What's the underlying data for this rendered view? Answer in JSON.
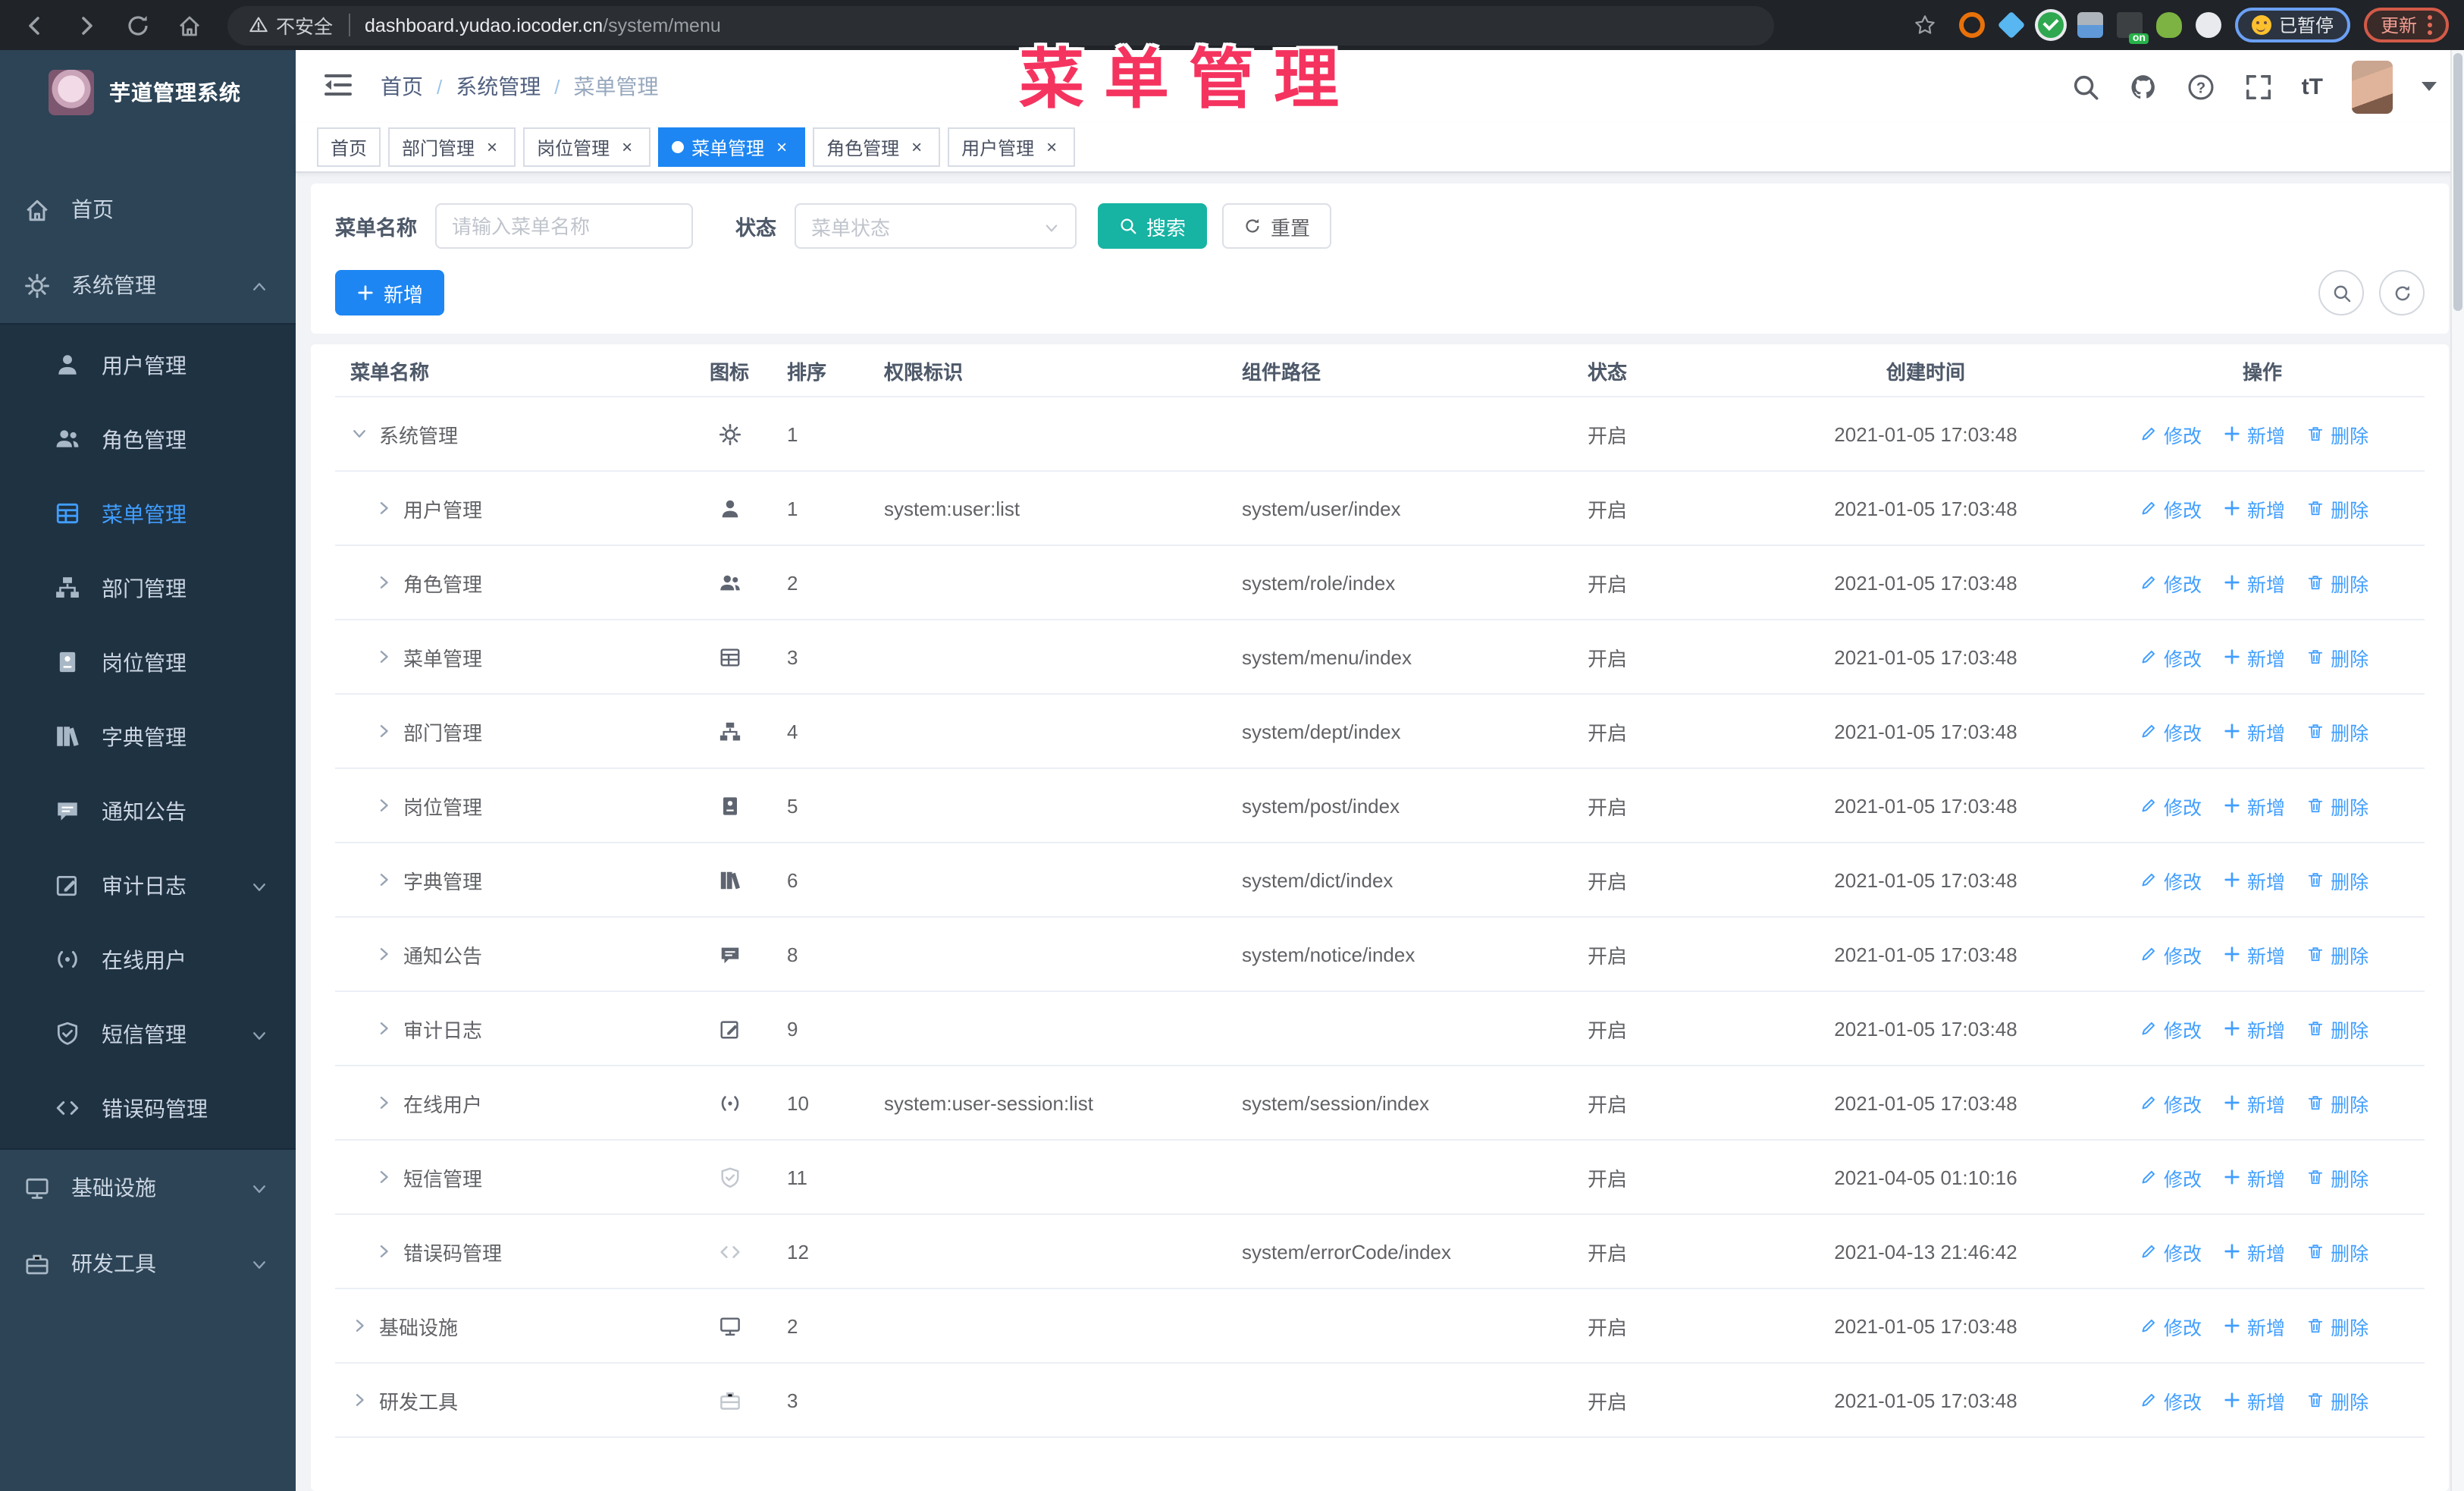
{
  "browser": {
    "not_secure": "不安全",
    "url_host": "dashboard.yudao.iocoder.cn",
    "url_path": "/system/menu",
    "paused_label": "已暂停",
    "update_label": "更新",
    "nav_icons": [
      "back-icon",
      "forward-icon",
      "reload-icon",
      "home-icon",
      "bookmark-star-icon"
    ]
  },
  "watermark": "菜单管理",
  "sidebar": {
    "app_title": "芋道管理系统",
    "items": [
      {
        "label": "首页",
        "icon": "home-icon",
        "level": 0
      },
      {
        "label": "系统管理",
        "icon": "gear-icon",
        "level": 0,
        "arrow": "up"
      },
      {
        "label": "用户管理",
        "icon": "user-icon",
        "level": 1
      },
      {
        "label": "角色管理",
        "icon": "users-icon",
        "level": 1
      },
      {
        "label": "菜单管理",
        "icon": "menu-icon",
        "level": 1,
        "active": true
      },
      {
        "label": "部门管理",
        "icon": "tree-icon",
        "level": 1
      },
      {
        "label": "岗位管理",
        "icon": "badge-icon",
        "level": 1
      },
      {
        "label": "字典管理",
        "icon": "dict-icon",
        "level": 1
      },
      {
        "label": "通知公告",
        "icon": "notice-icon",
        "level": 1
      },
      {
        "label": "审计日志",
        "icon": "log-icon",
        "level": 1,
        "arrow": "down"
      },
      {
        "label": "在线用户",
        "icon": "online-icon",
        "level": 1
      },
      {
        "label": "短信管理",
        "icon": "sms-icon",
        "level": 1,
        "arrow": "down"
      },
      {
        "label": "错误码管理",
        "icon": "code-icon",
        "level": 1
      },
      {
        "label": "基础设施",
        "icon": "monitor-icon",
        "level": 0,
        "arrow": "down"
      },
      {
        "label": "研发工具",
        "icon": "tool-icon",
        "level": 0,
        "arrow": "down"
      }
    ]
  },
  "header": {
    "breadcrumb": [
      "首页",
      "系统管理",
      "菜单管理"
    ],
    "right_icons": [
      "search-icon",
      "github-icon",
      "help-icon",
      "fullscreen-icon",
      "font-size-icon",
      "avatar",
      "caret-down-icon"
    ]
  },
  "tags": [
    {
      "label": "首页",
      "closable": false,
      "active": false
    },
    {
      "label": "部门管理",
      "closable": true,
      "active": false
    },
    {
      "label": "岗位管理",
      "closable": true,
      "active": false
    },
    {
      "label": "菜单管理",
      "closable": true,
      "active": true
    },
    {
      "label": "角色管理",
      "closable": true,
      "active": false
    },
    {
      "label": "用户管理",
      "closable": true,
      "active": false
    }
  ],
  "search": {
    "name_label": "菜单名称",
    "name_placeholder": "请输入菜单名称",
    "status_label": "状态",
    "status_placeholder": "菜单状态",
    "search_label": "搜索",
    "reset_label": "重置"
  },
  "toolbar": {
    "add_label": "新增"
  },
  "table": {
    "headers": [
      "菜单名称",
      "图标",
      "排序",
      "权限标识",
      "组件路径",
      "状态",
      "创建时间",
      "操作"
    ],
    "actions": {
      "edit": "修改",
      "add": "新增",
      "delete": "删除"
    },
    "rows": [
      {
        "name": "系统管理",
        "icon": "gear-icon",
        "level": 0,
        "expanded": true,
        "sort": "1",
        "perm": "",
        "path": "",
        "status": "开启",
        "time": "2021-01-05 17:03:48"
      },
      {
        "name": "用户管理",
        "icon": "user-icon",
        "level": 1,
        "sort": "1",
        "perm": "system:user:list",
        "path": "system/user/index",
        "status": "开启",
        "time": "2021-01-05 17:03:48"
      },
      {
        "name": "角色管理",
        "icon": "users-icon",
        "level": 1,
        "sort": "2",
        "perm": "",
        "path": "system/role/index",
        "status": "开启",
        "time": "2021-01-05 17:03:48"
      },
      {
        "name": "菜单管理",
        "icon": "menu-icon",
        "level": 1,
        "sort": "3",
        "perm": "",
        "path": "system/menu/index",
        "status": "开启",
        "time": "2021-01-05 17:03:48"
      },
      {
        "name": "部门管理",
        "icon": "tree-icon",
        "level": 1,
        "sort": "4",
        "perm": "",
        "path": "system/dept/index",
        "status": "开启",
        "time": "2021-01-05 17:03:48"
      },
      {
        "name": "岗位管理",
        "icon": "badge-icon",
        "level": 1,
        "sort": "5",
        "perm": "",
        "path": "system/post/index",
        "status": "开启",
        "time": "2021-01-05 17:03:48"
      },
      {
        "name": "字典管理",
        "icon": "dict-icon",
        "level": 1,
        "sort": "6",
        "perm": "",
        "path": "system/dict/index",
        "status": "开启",
        "time": "2021-01-05 17:03:48"
      },
      {
        "name": "通知公告",
        "icon": "notice-icon",
        "level": 1,
        "sort": "8",
        "perm": "",
        "path": "system/notice/index",
        "status": "开启",
        "time": "2021-01-05 17:03:48"
      },
      {
        "name": "审计日志",
        "icon": "log-icon",
        "level": 1,
        "sort": "9",
        "perm": "",
        "path": "",
        "status": "开启",
        "time": "2021-01-05 17:03:48"
      },
      {
        "name": "在线用户",
        "icon": "online-icon",
        "level": 1,
        "sort": "10",
        "perm": "system:user-session:list",
        "path": "system/session/index",
        "status": "开启",
        "time": "2021-01-05 17:03:48"
      },
      {
        "name": "短信管理",
        "icon": "sms-icon",
        "light": true,
        "level": 1,
        "sort": "11",
        "perm": "",
        "path": "",
        "status": "开启",
        "time": "2021-04-05 01:10:16"
      },
      {
        "name": "错误码管理",
        "icon": "code-icon",
        "light": true,
        "level": 1,
        "sort": "12",
        "perm": "",
        "path": "system/errorCode/index",
        "status": "开启",
        "time": "2021-04-13 21:46:42"
      },
      {
        "name": "基础设施",
        "icon": "monitor-icon",
        "level": 0,
        "sort": "2",
        "perm": "",
        "path": "",
        "status": "开启",
        "time": "2021-01-05 17:03:48"
      },
      {
        "name": "研发工具",
        "icon": "tool-icon",
        "light": true,
        "level": 0,
        "sort": "3",
        "perm": "",
        "path": "",
        "status": "开启",
        "time": "2021-01-05 17:03:48"
      }
    ]
  },
  "colors": {
    "accent_blue": "#409eff",
    "primary_button_blue": "#1d86f2",
    "search_button_teal": "#17b3a3",
    "watermark_pink": "#f5335f",
    "sidebar_bg": "#2c4456",
    "sidebar_submenu_bg": "#1f3242"
  }
}
